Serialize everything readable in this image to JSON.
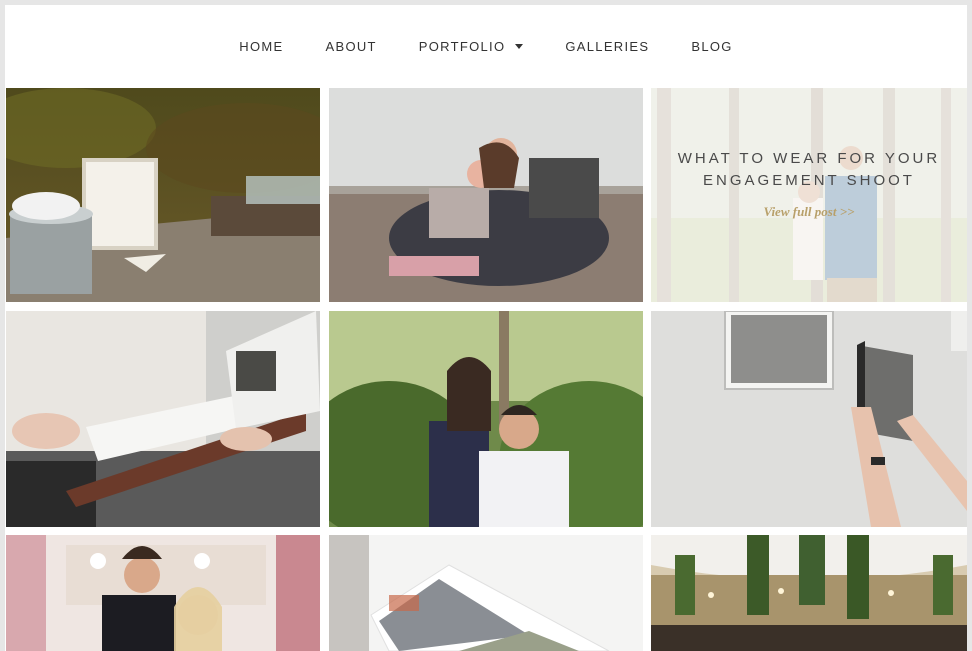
{
  "nav": {
    "items": [
      {
        "label": "HOME",
        "has_dropdown": false
      },
      {
        "label": "ABOUT",
        "has_dropdown": false
      },
      {
        "label": "PORTFOLIO",
        "has_dropdown": true
      },
      {
        "label": "GALLERIES",
        "has_dropdown": false
      },
      {
        "label": "BLOG",
        "has_dropdown": false
      }
    ]
  },
  "grid": {
    "featured_post": {
      "title_line1": "WHAT TO WEAR FOR YOUR",
      "title_line2": "ENGAGEMENT SHOOT",
      "link_label": "View full post >>"
    }
  },
  "colors": {
    "accent_gold": "#b8a06a",
    "nav_text": "#333333",
    "page_bg": "#ffffff",
    "outer_bg": "#e6e6e6"
  }
}
